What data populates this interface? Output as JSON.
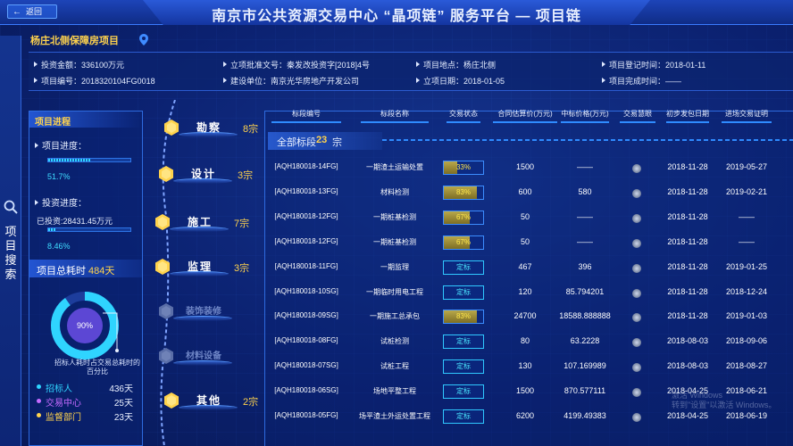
{
  "header": {
    "back_label": "返回",
    "title": "南京市公共资源交易中心 “晶项链” 服务平台 — 项目链"
  },
  "sidebar": {
    "label": "项目搜索",
    "icon": "search-icon"
  },
  "project": {
    "name": "杨庄北侧保障房项目",
    "info": [
      {
        "label": "投资金额：",
        "value": "336100万元"
      },
      {
        "label": "立项批准文号：",
        "value": "秦发改投资字[2018]4号"
      },
      {
        "label": "项目地点：",
        "value": "杨庄北侧"
      },
      {
        "label": "项目登记时间：",
        "value": "2018-01-11"
      },
      {
        "label": "项目编号：",
        "value": "2018320104FG0018"
      },
      {
        "label": "建设单位：",
        "value": "南京光华房地产开发公司"
      },
      {
        "label": "立项日期：",
        "value": "2018-01-05"
      },
      {
        "label": "项目完成时间：",
        "value": "——"
      }
    ]
  },
  "progress_panel": {
    "title": "项目进程",
    "progress_label": "项目进度：",
    "progress_value": 0.517,
    "progress_text": "51.7%",
    "invest_label": "投资进度：",
    "invest_sub": "已投资:28431.45万元",
    "invest_value": 0.0846,
    "invest_text": "8.46%",
    "total_label": "项目总耗时",
    "total_value": "484天",
    "donut_value": 0.9,
    "donut_text": "90%",
    "donut_note": "招标人耗时占交易总耗时的百分比",
    "legend": [
      {
        "name": "招标人",
        "value": "436天",
        "color": "#2fd4ff"
      },
      {
        "name": "交易中心",
        "value": "25天",
        "color": "#c56bff"
      },
      {
        "name": "监督部门",
        "value": "23天",
        "color": "#ffd34d"
      }
    ]
  },
  "timeline": [
    {
      "name": "勘察",
      "count": "8宗",
      "active": true
    },
    {
      "name": "设计",
      "count": "3宗",
      "active": true
    },
    {
      "name": "施工",
      "count": "7宗",
      "active": true
    },
    {
      "name": "监理",
      "count": "3宗",
      "active": true
    },
    {
      "name": "装饰装修",
      "count": "",
      "active": false
    },
    {
      "name": "材料设备",
      "count": "",
      "active": false
    },
    {
      "name": "其他",
      "count": "2宗",
      "active": true
    }
  ],
  "table": {
    "headers": [
      "标段编号",
      "标段名称",
      "交易状态",
      "合同估算价(万元)",
      "中标价格(万元)",
      "交易慧眼",
      "初步发包日期",
      "进场交易证明"
    ],
    "all_label": "全部标段",
    "all_count": "23",
    "all_unit": "宗",
    "rows": [
      {
        "code": "[AQH180018-14FG]",
        "name": "一期渣土运输处置",
        "status": "33%",
        "pct": 0.33,
        "est": "1500",
        "bid": "——",
        "date": "2018-11-28",
        "proof": "2019-05-27"
      },
      {
        "code": "[AQH180018-13FG]",
        "name": "材料检测",
        "status": "83%",
        "pct": 0.83,
        "est": "600",
        "bid": "580",
        "date": "2018-11-28",
        "proof": "2019-02-21"
      },
      {
        "code": "[AQH180018-12FG]",
        "name": "一期桩基检测",
        "status": "67%",
        "pct": 0.67,
        "est": "50",
        "bid": "——",
        "date": "2018-11-28",
        "proof": "——"
      },
      {
        "code": "[AQH180018-12FG]",
        "name": "一期桩基检测",
        "status": "67%",
        "pct": 0.67,
        "est": "50",
        "bid": "——",
        "date": "2018-11-28",
        "proof": "——"
      },
      {
        "code": "[AQH180018-11FG]",
        "name": "一期监理",
        "status": "定标",
        "pct": null,
        "est": "467",
        "bid": "396",
        "date": "2018-11-28",
        "proof": "2019-01-25"
      },
      {
        "code": "[AQH180018-10SG]",
        "name": "一期临时用电工程",
        "status": "定标",
        "pct": null,
        "est": "120",
        "bid": "85.794201",
        "date": "2018-11-28",
        "proof": "2018-12-24"
      },
      {
        "code": "[AQH180018-09SG]",
        "name": "一期施工总承包",
        "status": "83%",
        "pct": 0.83,
        "est": "24700",
        "bid": "18588.888888",
        "date": "2018-11-28",
        "proof": "2019-01-03"
      },
      {
        "code": "[AQH180018-08FG]",
        "name": "试桩检测",
        "status": "定标",
        "pct": null,
        "est": "80",
        "bid": "63.2228",
        "date": "2018-08-03",
        "proof": "2018-09-06"
      },
      {
        "code": "[AQH180018-07SG]",
        "name": "试桩工程",
        "status": "定标",
        "pct": null,
        "est": "130",
        "bid": "107.169989",
        "date": "2018-08-03",
        "proof": "2018-08-27"
      },
      {
        "code": "[AQH180018-06SG]",
        "name": "场地平整工程",
        "status": "定标",
        "pct": null,
        "est": "1500",
        "bid": "870.577111",
        "date": "2018-04-25",
        "proof": "2018-06-21"
      },
      {
        "code": "[AQH180018-05FG]",
        "name": "场平渣土外运处置工程",
        "status": "定标",
        "pct": null,
        "est": "6200",
        "bid": "4199.49383",
        "date": "2018-04-25",
        "proof": "2018-06-19"
      }
    ]
  },
  "watermark": {
    "line1": "激活 Windows",
    "line2": "转到\"设置\"以激活 Windows。"
  }
}
